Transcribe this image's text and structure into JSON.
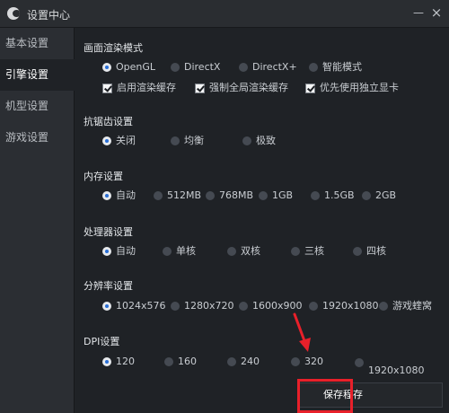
{
  "window": {
    "title": "设置中心",
    "minimize": "—",
    "close": "×"
  },
  "sidebar": {
    "items": [
      {
        "label": "基本设置",
        "active": false
      },
      {
        "label": "引擎设置",
        "active": true
      },
      {
        "label": "机型设置",
        "active": false
      },
      {
        "label": "游戏设置",
        "active": false
      }
    ]
  },
  "render": {
    "title": "画面渲染模式",
    "options": [
      "OpenGL",
      "DirectX",
      "DirectX+",
      "智能模式"
    ],
    "selected": "OpenGL",
    "checks": [
      {
        "label": "启用渲染缓存",
        "checked": true
      },
      {
        "label": "强制全局渲染缓存",
        "checked": true
      },
      {
        "label": "优先使用独立显卡",
        "checked": true
      }
    ]
  },
  "aa": {
    "title": "抗锯齿设置",
    "options": [
      "关闭",
      "均衡",
      "极致"
    ],
    "selected": "关闭"
  },
  "memory": {
    "title": "内存设置",
    "options": [
      "自动",
      "512MB",
      "768MB",
      "1GB",
      "1.5GB",
      "2GB"
    ],
    "selected": "自动"
  },
  "cpu": {
    "title": "处理器设置",
    "options": [
      "自动",
      "单核",
      "双核",
      "三核",
      "四核"
    ],
    "selected": "自动"
  },
  "resolution": {
    "title": "分辨率设置",
    "options": [
      "1024x576",
      "1280x720",
      "1600x900",
      "1920x1080",
      "游戏蝰窝"
    ],
    "selected": "1024x576"
  },
  "dpi": {
    "title": "DPI设置",
    "options": [
      "120",
      "160",
      "240",
      "320",
      "1920x1080"
    ],
    "selected": "120"
  },
  "footer": {
    "save_label": "保存程存"
  },
  "colors": {
    "accent": "#2a6fd6",
    "highlight": "#e8202a",
    "background": "#1f2226"
  }
}
